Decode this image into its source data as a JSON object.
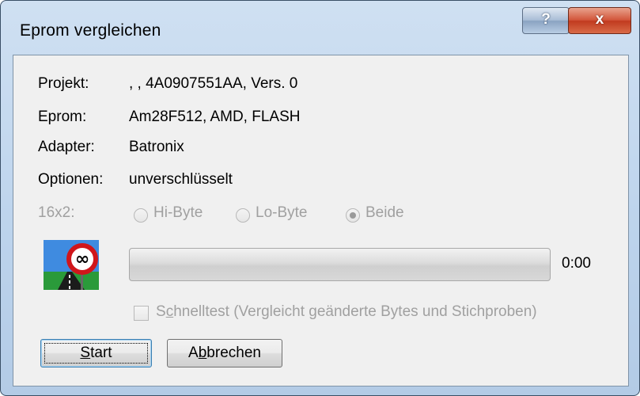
{
  "window": {
    "title": "Eprom vergleichen",
    "help_symbol": "?",
    "close_symbol": "x"
  },
  "info": {
    "project_label": "Projekt:",
    "project_value": ", , 4A0907551AA, Vers. 0",
    "eprom_label": "Eprom:",
    "eprom_value": "Am28F512, AMD, FLASH",
    "adapter_label": "Adapter:",
    "adapter_value": "Batronix",
    "options_label": "Optionen:",
    "options_value": "unverschlüsselt"
  },
  "mode": {
    "label": "16x2:",
    "options": [
      "Hi-Byte",
      "Lo-Byte",
      "Beide"
    ],
    "selected": "Beide"
  },
  "progress": {
    "value": 0,
    "time": "0:00"
  },
  "quicktest": {
    "label_prefix": "S",
    "label_accel": "c",
    "label_rest": "hnelltest (Vergleicht geänderte Bytes und Stichproben)",
    "checked": false
  },
  "buttons": {
    "start_accel": "S",
    "start_rest": "tart",
    "cancel_prefix": "A",
    "cancel_accel": "b",
    "cancel_rest": "brechen"
  },
  "icon": "infinity-road-sign-icon"
}
